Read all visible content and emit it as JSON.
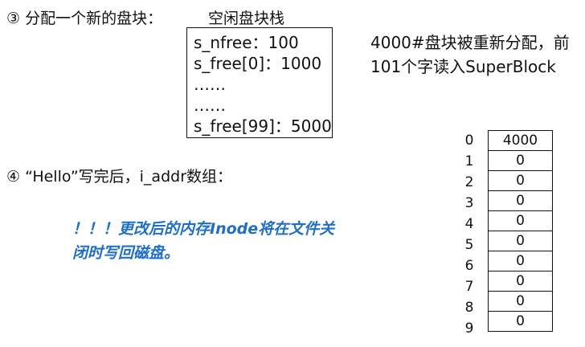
{
  "step3_label": "③ 分配一个新的盘块：",
  "stack_title": "空闲盘块栈",
  "stack_lines": [
    "s_nfree：100",
    "s_free[0]：1000",
    "……",
    "……",
    "s_free[99]：5000"
  ],
  "right_note": {
    "line1": "4000#盘块被重新分配，前",
    "line2": "101个字读入SuperBlock"
  },
  "step4_label": "④ “Hello”写完后，i_addr数组：",
  "warning": {
    "line1": "！！！更改后的内存Inode将在文件关",
    "line2": "闭时写回磁盘。"
  },
  "i_addr": {
    "indices": [
      "0",
      "1",
      "2",
      "3",
      "4",
      "5",
      "6",
      "7",
      "8",
      "9"
    ],
    "values": [
      "4000",
      "0",
      "0",
      "0",
      "0",
      "0",
      "0",
      "0",
      "0",
      "0"
    ]
  },
  "colors": {
    "warning_text": "#1f6fc5"
  }
}
